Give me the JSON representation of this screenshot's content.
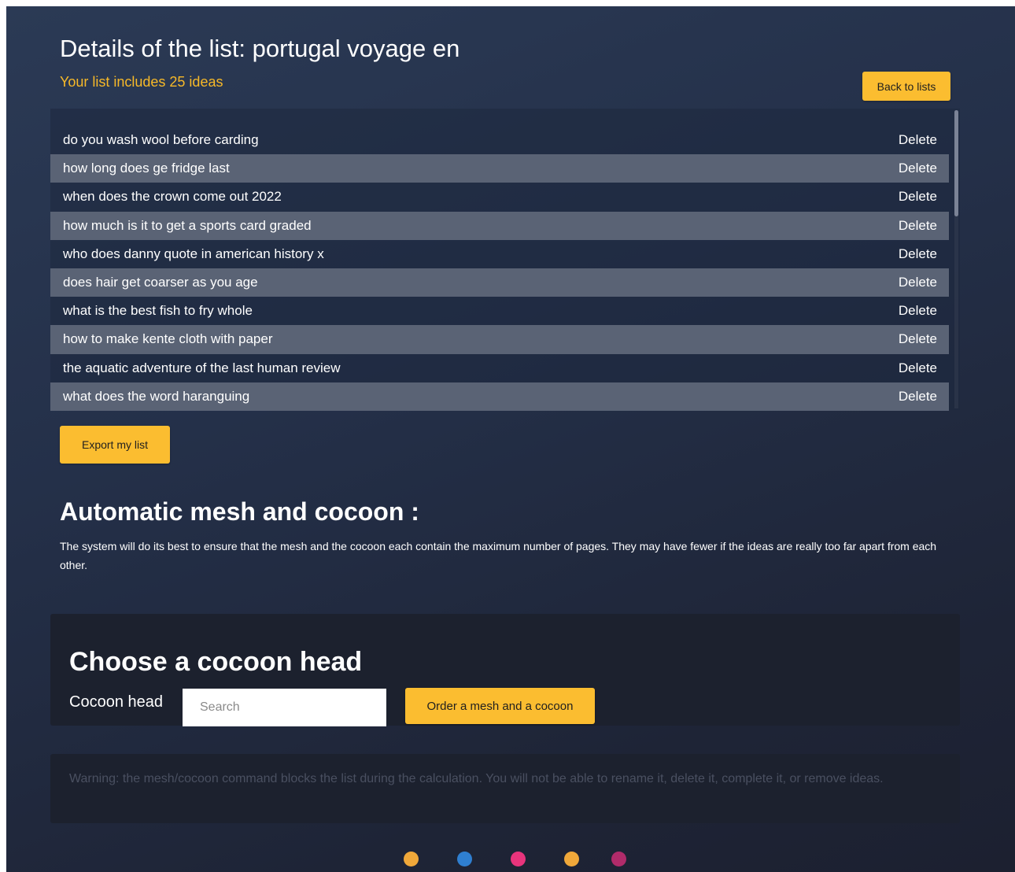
{
  "header": {
    "title": "Details of the list: portugal voyage en",
    "subtitle": "Your list includes 25 ideas",
    "back_label": "Back to lists"
  },
  "list": {
    "delete_label": "Delete",
    "items": [
      "do you wash wool before carding",
      "how long does ge fridge last",
      "when does the crown come out 2022",
      "how much is it to get a sports card graded",
      "who does danny quote in american history x",
      "does hair get coarser as you age",
      "what is the best fish to fry whole",
      "how to make kente cloth with paper",
      "the aquatic adventure of the last human review",
      "what does the word haranguing"
    ]
  },
  "export_label": "Export my list",
  "auto": {
    "title": "Automatic mesh and cocoon :",
    "description": "The system will do its best to ensure that the mesh and the cocoon each contain the maximum number of pages. They may have fewer if the ideas are really too far apart from each other."
  },
  "cocoon": {
    "title": "Choose a cocoon head",
    "label": "Cocoon head",
    "search_placeholder": "Search",
    "search_value": "",
    "order_label": "Order a mesh and a cocoon"
  },
  "warning": "Warning: the mesh/cocoon command blocks the list during the calculation. You will not be able to rename it, delete it, complete it, or remove ideas.",
  "colors": {
    "accent": "#fbbd30",
    "subtitle": "#f7b928",
    "row_alt": "#5a6375",
    "dots": [
      "#f0a83a",
      "#2f7fd0",
      "#e8347c",
      "#f0a83a",
      "#b02b6a"
    ]
  }
}
